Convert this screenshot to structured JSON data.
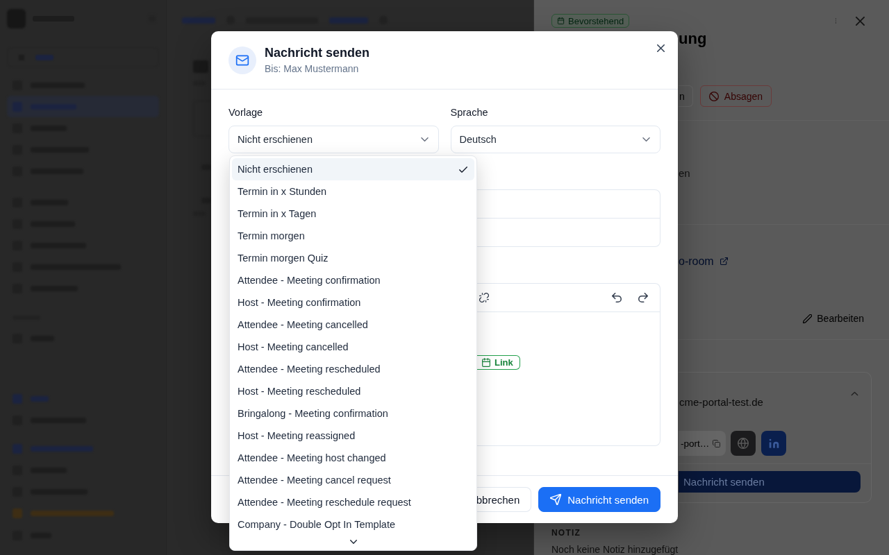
{
  "detail_panel": {
    "status_badge": "Bevorstehend",
    "title": "ung",
    "actions": [
      {
        "label": "n",
        "kind": "outline"
      },
      {
        "label": "Absagen",
        "kind": "danger"
      }
    ],
    "info_text": "en",
    "meeting_link": "o-room",
    "edit_button": "Bearbeiten",
    "contact_card": {
      "expanded": true,
      "email": "cme-portal-test.de",
      "link_field": "-port…",
      "send_button": "Nachricht senden"
    },
    "note": {
      "heading": "NOTIZ",
      "text": "Noch keine Notiz hinzugefügt"
    }
  },
  "dialog": {
    "title": "Nachricht senden",
    "recipient": "Bis: Max Mustermann",
    "fields": [
      {
        "label": "Vorlage",
        "value": "Nicht erschienen"
      },
      {
        "label": "Sprache",
        "value": "Deutsch"
      }
    ],
    "editor": {
      "chip": "Link"
    },
    "buttons": [
      {
        "label": "bbrechen",
        "kind": "secondary"
      },
      {
        "label": "Nachricht senden",
        "kind": "primary"
      }
    ]
  },
  "template_menu": {
    "options": [
      {
        "label": "Nicht erschienen",
        "selected": true
      },
      {
        "label": "Termin in x Stunden",
        "selected": false
      },
      {
        "label": "Termin in x Tagen",
        "selected": false
      },
      {
        "label": "Termin morgen",
        "selected": false
      },
      {
        "label": "Termin morgen Quiz",
        "selected": false
      },
      {
        "label": "Attendee - Meeting confirmation",
        "selected": false
      },
      {
        "label": "Host - Meeting confirmation",
        "selected": false
      },
      {
        "label": "Attendee - Meeting cancelled",
        "selected": false
      },
      {
        "label": "Host - Meeting cancelled",
        "selected": false
      },
      {
        "label": "Attendee - Meeting rescheduled",
        "selected": false
      },
      {
        "label": "Host - Meeting rescheduled",
        "selected": false
      },
      {
        "label": "Bringalong - Meeting confirmation",
        "selected": false
      },
      {
        "label": "Host - Meeting reassigned",
        "selected": false
      },
      {
        "label": "Attendee - Meeting host changed",
        "selected": false
      },
      {
        "label": "Attendee - Meeting cancel request",
        "selected": false
      },
      {
        "label": "Attendee - Meeting reschedule request",
        "selected": false
      },
      {
        "label": "Company - Double Opt In Template",
        "selected": false
      }
    ],
    "more_below": true
  }
}
